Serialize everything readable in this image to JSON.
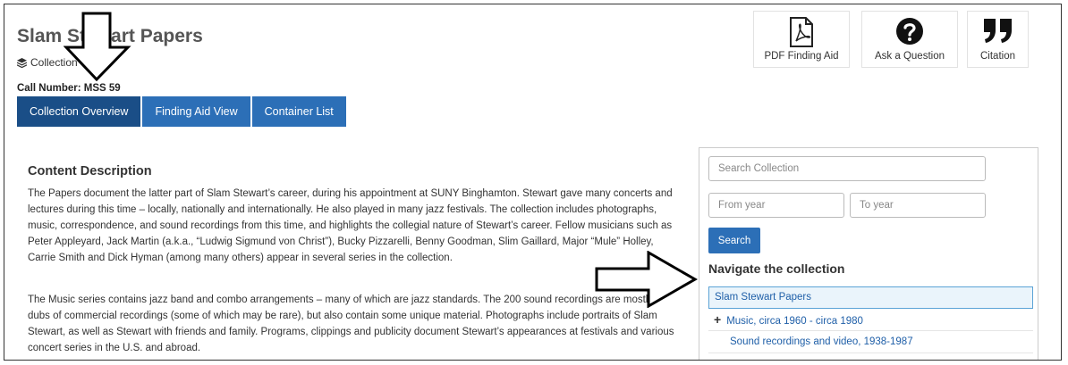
{
  "page": {
    "title": "Slam Stewart Papers",
    "collection_label": "Collection",
    "call_number": "Call Number: MSS 59"
  },
  "tabs": [
    {
      "label": "Collection Overview",
      "active": true
    },
    {
      "label": "Finding Aid View",
      "active": false
    },
    {
      "label": "Container List",
      "active": false
    }
  ],
  "actions": {
    "pdf": {
      "label": "PDF Finding Aid",
      "icon": "pdf-file-icon"
    },
    "ask": {
      "label": "Ask a Question",
      "icon": "question-circle-icon"
    },
    "cite": {
      "label": "Citation",
      "icon": "quote-icon"
    }
  },
  "content": {
    "heading": "Content Description",
    "paragraphs": [
      "The Papers document the latter part of Slam Stewart’s career, during his appointment at SUNY Binghamton. Stewart gave many concerts and lectures during this time – locally, nationally and internationally. He also played in many jazz festivals. The collection includes photographs, music, correspondence, and sound recordings from this time, and highlights the collegial nature of Stewart’s career. Fellow musicians such as Peter Appleyard, Jack Martin (a.k.a., “Ludwig Sigmund von Christ”), Bucky Pizzarelli, Benny Goodman, Slim Gaillard, Major “Mule” Holley, Carrie Smith and Dick Hyman (among many others) appear in several series in the collection.",
      "The Music series contains jazz band and combo arrangements – many of which are jazz standards. The 200 sound recordings are mostly dubs of commercial recordings (some of which may be rare), but also contain some unique material. Photographs include portraits of Slam Stewart, as well as Stewart with friends and family. Programs, clippings and publicity document Stewart’s appearances at festivals and various concert series in the U.S. and abroad."
    ]
  },
  "sidebar": {
    "search_placeholder": "Search Collection",
    "from_placeholder": "From year",
    "to_placeholder": "To year",
    "search_button": "Search",
    "nav_heading": "Navigate the collection",
    "tree": {
      "root": "Slam Stewart Papers",
      "items": [
        {
          "label": "Music, circa 1960 - circa 1980",
          "expandable": true
        },
        {
          "label": "Sound recordings and video, 1938-1987",
          "expandable": false
        }
      ]
    }
  },
  "colors": {
    "tab": "#2c6fb7",
    "tab_active": "#1a4e87",
    "link": "#1f5fa8"
  }
}
